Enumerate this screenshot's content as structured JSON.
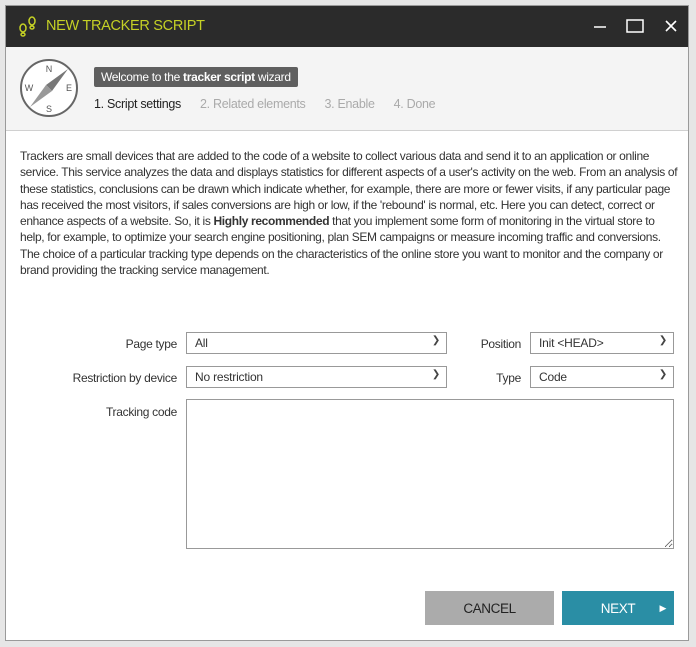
{
  "window": {
    "title": "NEW TRACKER SCRIPT",
    "title_color": "#c5d125",
    "icons": [
      "footprints-icon",
      "minimize-icon",
      "maximize-icon",
      "close-icon"
    ]
  },
  "header": {
    "welcome_prefix": "Welcome to the ",
    "welcome_bold": "tracker script",
    "welcome_suffix": " wizard",
    "compass": {
      "n": "N",
      "e": "E",
      "s": "S",
      "w": "W"
    },
    "steps": [
      {
        "label": "1. Script settings",
        "active": true
      },
      {
        "label": "2. Related elements",
        "active": false
      },
      {
        "label": "3. Enable",
        "active": false
      },
      {
        "label": "4. Done",
        "active": false
      }
    ]
  },
  "description": {
    "p1_before": "Trackers are small devices that are added to the code of a website to collect various data and send it to an application or online service. This service analyzes the data and displays statistics for different aspects of a user's activity on the web. From an analysis of these statistics, conclusions can be drawn which indicate whether, for example, there are more or fewer visits, if any particular page has received the most visitors, if sales conversions are high or low, if the 'rebound' is normal, etc. Here you can detect, correct or enhance aspects of a website. So, it is ",
    "p1_bold": "Highly recommended",
    "p1_after": " that you implement some form of monitoring in the virtual store to help, for example, to optimize your search engine positioning, plan SEM campaigns or measure incoming traffic and conversions.",
    "p2": "The choice of a particular tracking type depends on the characteristics of the online store you want to monitor and the company or brand providing the tracking service management."
  },
  "form": {
    "page_type": {
      "label": "Page type",
      "value": "All"
    },
    "position": {
      "label": "Position",
      "value": "Init <HEAD>"
    },
    "restriction": {
      "label": "Restriction by device",
      "value": "No restriction"
    },
    "type": {
      "label": "Type",
      "value": "Code"
    },
    "tracking_code": {
      "label": "Tracking code",
      "value": ""
    }
  },
  "buttons": {
    "cancel": "CANCEL",
    "next": "NEXT"
  }
}
